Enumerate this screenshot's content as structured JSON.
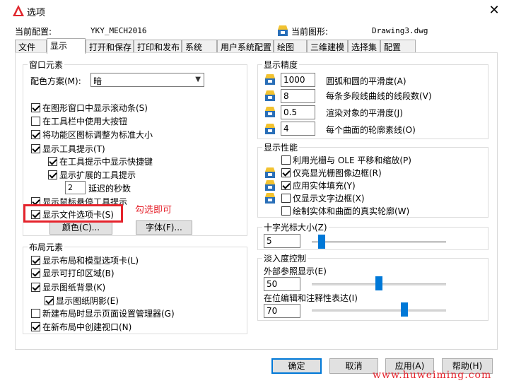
{
  "window": {
    "title": "选项"
  },
  "header": {
    "profile_label": "当前配置:",
    "profile_value": "YKY_MECH2016",
    "drawing_label": "当前图形:",
    "drawing_value": "Drawing3.dwg"
  },
  "tabs": [
    {
      "label": "文件",
      "active": false
    },
    {
      "label": "显示",
      "active": true
    },
    {
      "label": "打开和保存",
      "active": false
    },
    {
      "label": "打印和发布",
      "active": false
    },
    {
      "label": "系统",
      "active": false
    },
    {
      "label": "用户系统配置",
      "active": false
    },
    {
      "label": "绘图",
      "active": false
    },
    {
      "label": "三维建模",
      "active": false
    },
    {
      "label": "选择集",
      "active": false
    },
    {
      "label": "配置",
      "active": false
    }
  ],
  "window_elements": {
    "title": "窗口元素",
    "scheme_label": "配色方案(M):",
    "scheme_value": "暗",
    "items": [
      {
        "label": "在图形窗口中显示滚动条(S)",
        "checked": true
      },
      {
        "label": "在工具栏中使用大按钮",
        "checked": false
      },
      {
        "label": "将功能区图标调整为标准大小",
        "checked": true
      },
      {
        "label": "显示工具提示(T)",
        "checked": true
      },
      {
        "label": "在工具提示中显示快捷键",
        "checked": true
      },
      {
        "label": "显示扩展的工具提示",
        "checked": true
      },
      {
        "label": "显示鼠标悬停工具提示",
        "checked": true
      },
      {
        "label": "显示文件选项卡(S)",
        "checked": true
      }
    ],
    "delay_value": "2",
    "delay_label": "延迟的秒数",
    "colors_button": "颜色(C)...",
    "fonts_button": "字体(F)..."
  },
  "layout_elements": {
    "title": "布局元素",
    "items": [
      {
        "label": "显示布局和模型选项卡(L)",
        "checked": true
      },
      {
        "label": "显示可打印区域(B)",
        "checked": true
      },
      {
        "label": "显示图纸背景(K)",
        "checked": true
      },
      {
        "label": "显示图纸阴影(E)",
        "checked": true
      },
      {
        "label": "新建布局时显示页面设置管理器(G)",
        "checked": false
      },
      {
        "label": "在新布局中创建视口(N)",
        "checked": true
      }
    ]
  },
  "display_resolution": {
    "title": "显示精度",
    "items": [
      {
        "value": "1000",
        "label": "圆弧和圆的平滑度(A)"
      },
      {
        "value": "8",
        "label": "每条多段线曲线的线段数(V)"
      },
      {
        "value": "0.5",
        "label": "渲染对象的平滑度(J)"
      },
      {
        "value": "4",
        "label": "每个曲面的轮廓素线(O)"
      }
    ]
  },
  "display_performance": {
    "title": "显示性能",
    "items": [
      {
        "label": "利用光栅与 OLE 平移和缩放(P)",
        "checked": false
      },
      {
        "label": "仅亮显光栅图像边框(R)",
        "checked": true
      },
      {
        "label": "应用实体填充(Y)",
        "checked": true
      },
      {
        "label": "仅显示文字边框(X)",
        "checked": false
      },
      {
        "label": "绘制实体和曲面的真实轮廓(W)",
        "checked": false
      }
    ]
  },
  "crosshair": {
    "title": "十字光标大小(Z)",
    "value": "5",
    "slider_fraction": 0.05
  },
  "fade": {
    "title": "淡入度控制",
    "xref_label": "外部参照显示(E)",
    "xref_value": "50",
    "xref_fraction": 0.5,
    "inplace_label": "在位编辑和注释性表达(I)",
    "inplace_value": "70",
    "inplace_fraction": 0.7
  },
  "buttons": {
    "ok": "确定",
    "cancel": "取消",
    "apply": "应用(A)",
    "help": "帮助(H)"
  },
  "annotation": {
    "text": "勾选即可"
  },
  "watermark": {
    "text": "www.huweiming.com"
  },
  "colors": {
    "accent": "#0078d7",
    "annotation_red": "#e5232c"
  }
}
